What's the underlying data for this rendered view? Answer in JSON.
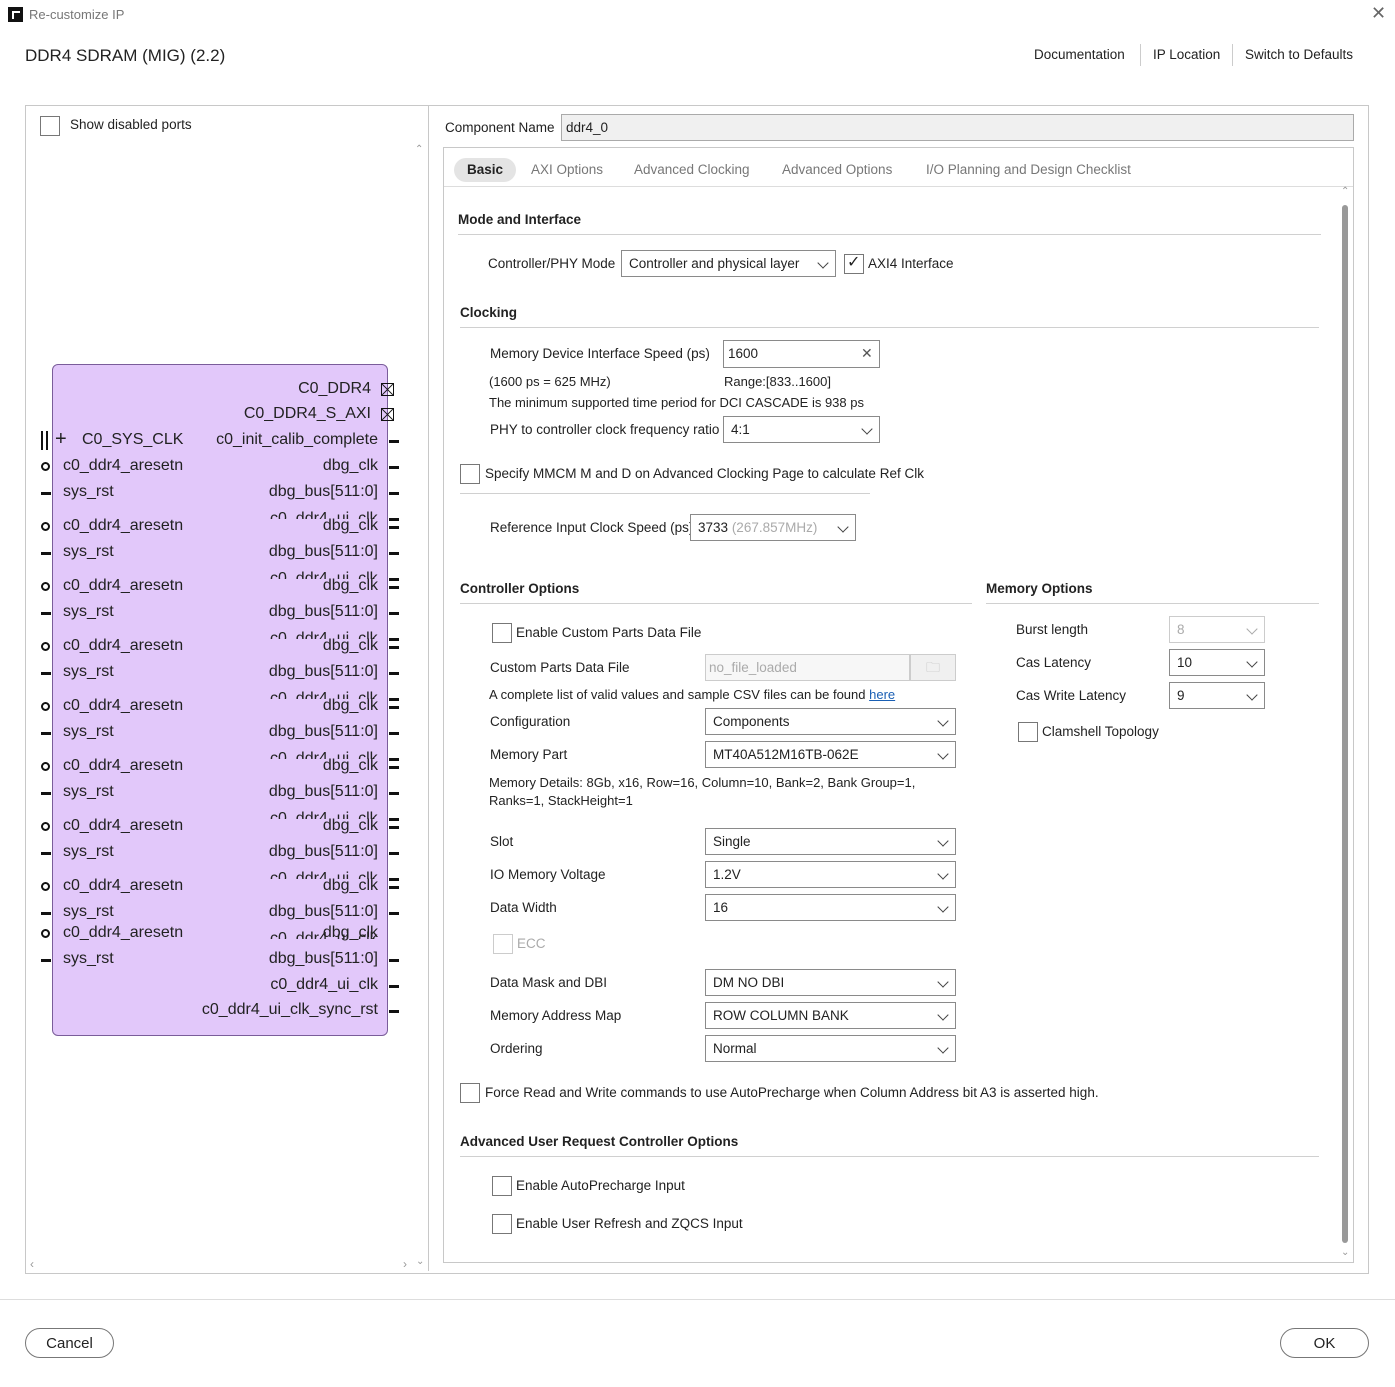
{
  "window": {
    "title": "Re-customize IP",
    "close": "✕"
  },
  "ip": {
    "title": "DDR4 SDRAM (MIG) (2.2)"
  },
  "toplinks": {
    "documentation": "Documentation",
    "ip_location": "IP Location",
    "switch_defaults": "Switch to Defaults"
  },
  "left": {
    "show_disabled_ports": "Show disabled ports",
    "block": {
      "top_pins": [
        "C0_DDR4",
        "C0_DDR4_S_AXI"
      ],
      "sys_clk": "C0_SYS_CLK",
      "init_calib": "c0_init_calib_complete",
      "aresetn": "c0_ddr4_aresetn",
      "sys_rst": "sys_rst",
      "dbg_clk": "dbg_clk",
      "dbg_bus": "dbg_bus[511:0]",
      "ui_clk": "c0_ddr4_ui_clk",
      "ui_clk_sync_rst": "c0_ddr4_ui_clk_sync_rst"
    }
  },
  "component": {
    "label": "Component Name",
    "value": "ddr4_0"
  },
  "tabs": [
    "Basic",
    "AXI Options",
    "Advanced Clocking",
    "Advanced Options",
    "I/O Planning and Design Checklist"
  ],
  "mode": {
    "section": "Mode and Interface",
    "phy_label": "Controller/PHY Mode",
    "phy_value": "Controller and physical layer",
    "axi4_label": "AXI4 Interface"
  },
  "clocking": {
    "section": "Clocking",
    "speed_label": "Memory Device Interface Speed (ps)",
    "speed_value": "1600",
    "speed_note": "(1600 ps = 625 MHz)",
    "range": "Range:[833..1600]",
    "dci_note": "The minimum supported time period for DCI CASCADE is 938 ps",
    "ratio_label": "PHY to controller clock frequency ratio",
    "ratio_value": "4:1",
    "mmcm_label": "Specify MMCM M and D on Advanced Clocking Page to calculate Ref Clk",
    "ref_label": "Reference Input Clock Speed (ps)",
    "ref_value": "3733",
    "ref_mhz": "(267.857MHz)"
  },
  "controller": {
    "section": "Controller Options",
    "custom_parts_cb": "Enable Custom Parts Data File",
    "custom_parts_label": "Custom Parts Data File",
    "custom_parts_value": "no_file_loaded",
    "csv_note": "A complete list of valid values and sample CSV files can be found",
    "csv_link": "here",
    "config_label": "Configuration",
    "config_value": "Components",
    "part_label": "Memory Part",
    "part_value": "MT40A512M16TB-062E",
    "details_line1": "Memory Details: 8Gb, x16, Row=16, Column=10, Bank=2, Bank Group=1,",
    "details_line2": "Ranks=1, StackHeight=1",
    "slot_label": "Slot",
    "slot_value": "Single",
    "voltage_label": "IO Memory Voltage",
    "voltage_value": "1.2V",
    "width_label": "Data Width",
    "width_value": "16",
    "ecc_label": "ECC",
    "dm_label": "Data Mask and DBI",
    "dm_value": "DM NO DBI",
    "addr_label": "Memory Address Map",
    "addr_value": "ROW COLUMN BANK",
    "order_label": "Ordering",
    "order_value": "Normal"
  },
  "memory": {
    "section": "Memory Options",
    "burst_label": "Burst length",
    "burst_value": "8",
    "cas_label": "Cas Latency",
    "cas_value": "10",
    "cwl_label": "Cas Write Latency",
    "cwl_value": "9",
    "clamshell_label": "Clamshell Topology"
  },
  "force_autoprecharge": "Force Read and Write commands to use AutoPrecharge when Column Address bit A3 is asserted high.",
  "advanced_user": {
    "section": "Advanced User Request Controller Options",
    "autoprecharge": "Enable AutoPrecharge Input",
    "refresh": "Enable User Refresh and ZQCS Input"
  },
  "buttons": {
    "cancel": "Cancel",
    "ok": "OK"
  }
}
